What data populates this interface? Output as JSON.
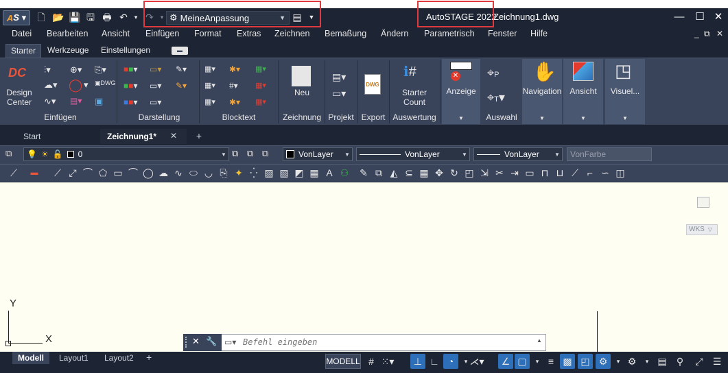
{
  "quick_access": {
    "workspace": "MeineAnpassung"
  },
  "title": {
    "app": "AutoSTAGE 2022",
    "file": "Zeichnung1.dwg"
  },
  "menu": [
    "Datei",
    "Bearbeiten",
    "Ansicht",
    "Einfügen",
    "Format",
    "Extras",
    "Zeichnen",
    "Bemaßung",
    "Ändern",
    "Parametrisch",
    "Fenster",
    "Hilfe"
  ],
  "ribbon_tabs": [
    "Starter",
    "Werkzeuge",
    "Einstellungen"
  ],
  "panels": {
    "design_center": "Design\nCenter",
    "einfuegen": "Einfügen",
    "darstellung": "Darstellung",
    "blocktext": "Blocktext",
    "neu": "Neu",
    "zeichnung": "Zeichnung",
    "projekt": "Projekt",
    "export": "Export",
    "starter_count": "Starter\nCount",
    "auswertung": "Auswertung",
    "anzeige": "Anzeige",
    "auswahl": "Auswahl",
    "navigation": "Navigation",
    "ansicht": "Ansicht",
    "visuel": "Visuel..."
  },
  "doc_tabs": {
    "start": "Start",
    "drawing": "Zeichnung1*"
  },
  "properties": {
    "layer": "0",
    "color": "VonLayer",
    "linetype": "VonLayer",
    "lineweight": "VonLayer",
    "plotstyle": "VonFarbe"
  },
  "canvas": {
    "y_axis": "Y",
    "x_axis": "X",
    "wks": "WKS"
  },
  "command": {
    "placeholder": "Befehl eingeben"
  },
  "layout_tabs": [
    "Modell",
    "Layout1",
    "Layout2"
  ],
  "status": {
    "modell": "MODELL"
  },
  "colors": {
    "accent": "#2d6fb8",
    "highlight": "#e0393e",
    "canvas": "#fffef2"
  }
}
